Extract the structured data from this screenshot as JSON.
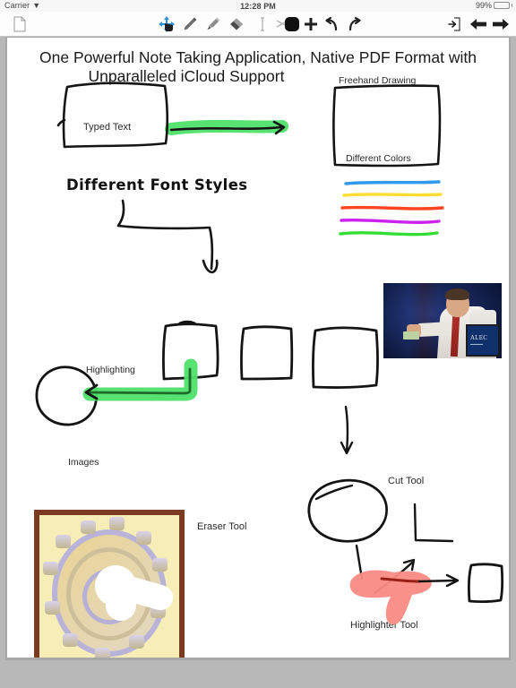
{
  "status_bar": {
    "carrier": "Carrier",
    "wifi_icon": "wifi-icon",
    "time": "12:28 PM",
    "battery_percent": "99%",
    "battery_level": 99,
    "battery_color": "#4cd964"
  },
  "toolbar": {
    "items": [
      {
        "name": "document-icon",
        "label": "Document"
      },
      {
        "name": "move-tool-icon",
        "label": "Move / Select Tool"
      },
      {
        "name": "pen-tool-icon",
        "label": "Pen"
      },
      {
        "name": "highlighter-tool-icon",
        "label": "Highlighter"
      },
      {
        "name": "eraser-tool-icon",
        "label": "Eraser"
      },
      {
        "name": "text-tool-icon",
        "label": "Text"
      },
      {
        "name": "cut-tool-icon",
        "label": "Cut"
      },
      {
        "name": "color-swatch-icon",
        "label": "Color"
      },
      {
        "name": "add-icon",
        "label": "Add"
      },
      {
        "name": "undo-icon",
        "label": "Undo"
      },
      {
        "name": "redo-icon",
        "label": "Redo"
      },
      {
        "name": "export-icon",
        "label": "Export"
      },
      {
        "name": "previous-page-icon",
        "label": "Previous Page"
      },
      {
        "name": "next-page-icon",
        "label": "Next Page"
      }
    ],
    "accent_color": "#2f8fd8",
    "color_swatch": "#111111"
  },
  "page": {
    "title_line_1": "One Powerful Note Taking Application, Native PDF Format with",
    "title_line_2": "Unparalleled iCloud Support",
    "labels": {
      "typed_text": "Typed Text",
      "different_font_styles": "Different Font Styles",
      "freehand_drawing": "Freehand Drawing",
      "different_colors": "Different Colors",
      "highlighting": "Highlighting",
      "images": "Images",
      "eraser_tool": "Eraser Tool",
      "cut_tool": "Cut Tool",
      "highlighter_tool": "Highlighter Tool"
    },
    "ink_colors": {
      "black": "#111111",
      "green_highlight": "#4ee06a",
      "pink_highlight": "#f98a84",
      "line_blue": "#3399ee",
      "line_yellow": "#ffdd33",
      "line_red": "#ff4422",
      "line_magenta": "#cc22ee",
      "line_green": "#33dd33"
    },
    "color_swatches": [
      {
        "name": "blue",
        "hex": "#3399ee"
      },
      {
        "name": "yellow",
        "hex": "#ffdd33"
      },
      {
        "name": "red",
        "hex": "#ff4422"
      },
      {
        "name": "magenta",
        "hex": "#cc22ee"
      },
      {
        "name": "green",
        "hex": "#33dd33"
      }
    ],
    "photos": [
      {
        "name": "speaker-photo",
        "alt": "Man in white shirt and red tie on stage"
      },
      {
        "name": "ornament-photo",
        "alt": "Decorative circular ornament on yellow background"
      }
    ]
  }
}
